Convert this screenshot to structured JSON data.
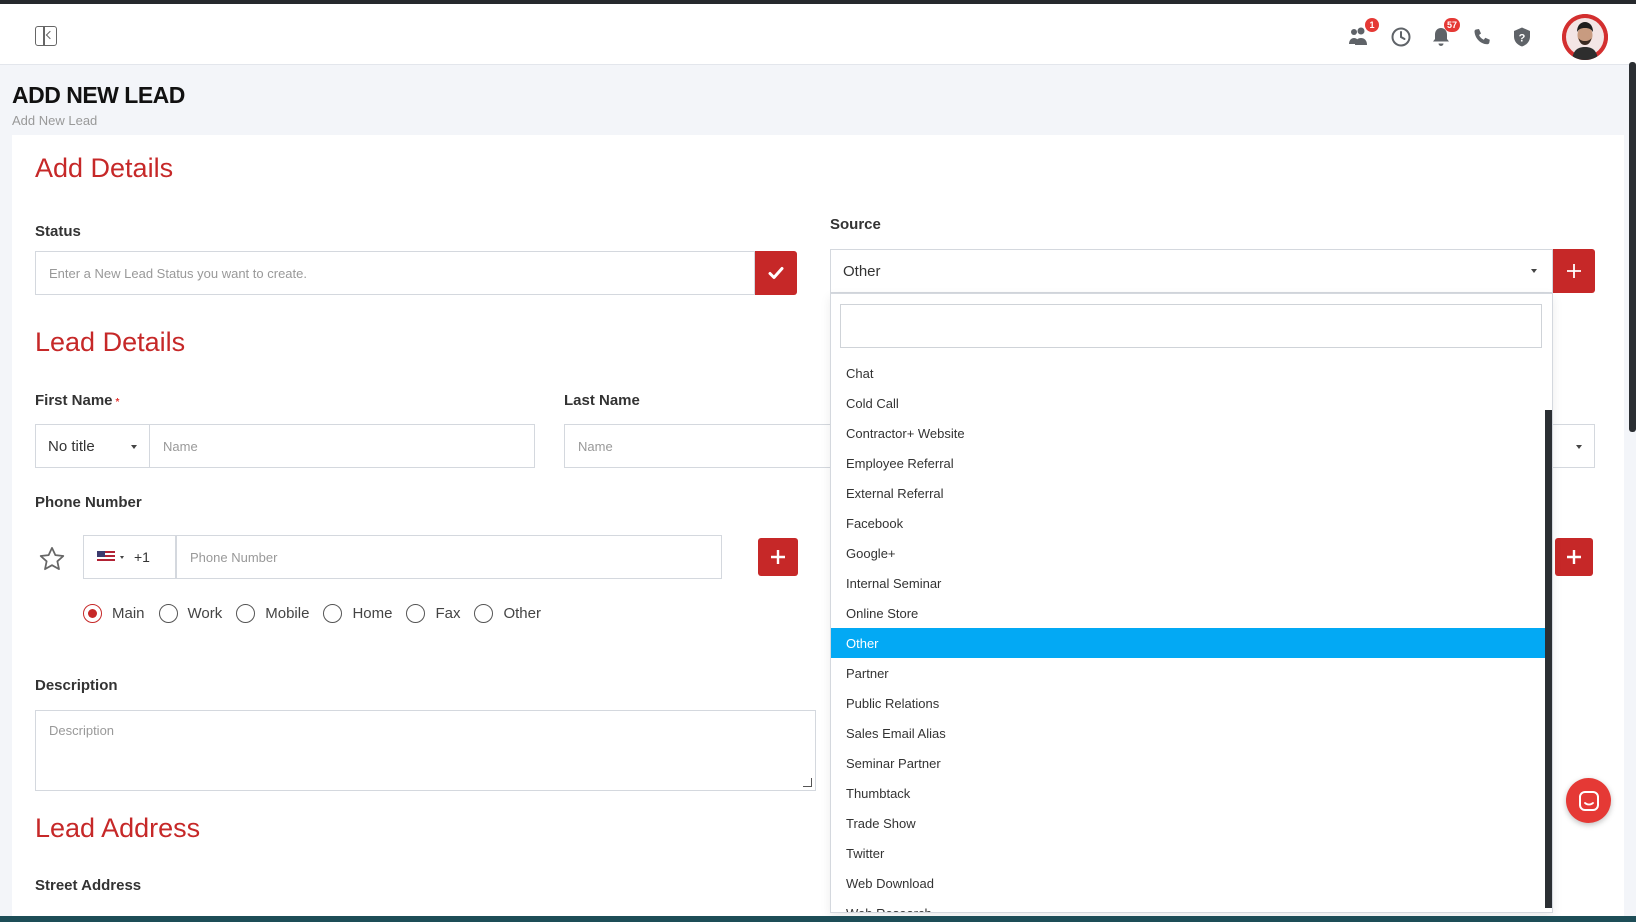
{
  "page": {
    "title": "ADD NEW LEAD",
    "breadcrumb": "Add New Lead"
  },
  "topbar": {
    "icons": [
      {
        "name": "team-icon",
        "badge": "1"
      },
      {
        "name": "clock-icon",
        "badge": ""
      },
      {
        "name": "bell-icon",
        "badge": "57"
      },
      {
        "name": "phone-icon",
        "badge": ""
      },
      {
        "name": "help-icon",
        "badge": ""
      }
    ]
  },
  "sections": {
    "add_details": "Add Details",
    "lead_details": "Lead Details",
    "lead_address": "Lead Address"
  },
  "status": {
    "label": "Status",
    "placeholder": "Enter a New Lead Status you want to create."
  },
  "source": {
    "label": "Source",
    "selected": "Other",
    "options": [
      "Chat",
      "Cold Call",
      "Contractor+ Website",
      "Employee Referral",
      "External Referral",
      "Facebook",
      "Google+",
      "Internal Seminar",
      "Online Store",
      "Other",
      "Partner",
      "Public Relations",
      "Sales Email Alias",
      "Seminar Partner",
      "Thumbtack",
      "Trade Show",
      "Twitter",
      "Web Download",
      "Web Research"
    ],
    "selected_index": 9
  },
  "first_name": {
    "label": "First Name",
    "required_mark": "*",
    "title_select": "No title",
    "placeholder": "Name"
  },
  "last_name": {
    "label": "Last Name",
    "placeholder": "Name"
  },
  "phone": {
    "label": "Phone Number",
    "country_code": "+1",
    "placeholder": "Phone Number",
    "types": [
      "Main",
      "Work",
      "Mobile",
      "Home",
      "Fax",
      "Other"
    ],
    "selected_type": "Main"
  },
  "description": {
    "label": "Description",
    "placeholder": "Description"
  },
  "address": {
    "street_label": "Street Address"
  },
  "colors": {
    "accent_red": "#c62828",
    "highlight_blue": "#03a9f4"
  }
}
